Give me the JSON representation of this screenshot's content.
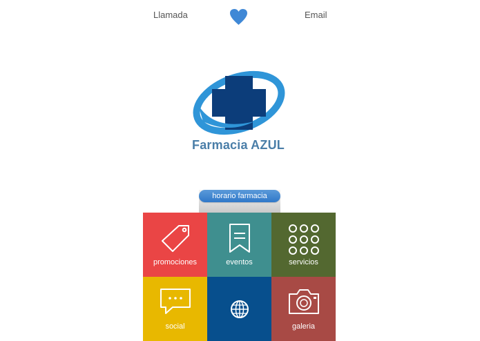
{
  "header": {
    "call_label": "Llamada",
    "email_label": "Email",
    "favorite_icon": "heart-icon"
  },
  "brand": {
    "name": "Farmacia AZUL",
    "logo_icon": "cross-logo-icon",
    "primary_color": "#0c3d7a",
    "accent_color": "#2f95d8"
  },
  "hours": {
    "label": "horario farmacia",
    "color": "#3a84d4"
  },
  "tiles": [
    {
      "label": "promociones",
      "icon": "tag-icon",
      "color": "#ea4545"
    },
    {
      "label": "eventos",
      "icon": "bookmark-icon",
      "color": "#3f8f8f"
    },
    {
      "label": "servicios",
      "icon": "dots-grid-icon",
      "color": "#536830"
    },
    {
      "label": "social",
      "icon": "chat-bubble-icon",
      "color": "#e8b800"
    },
    {
      "label": "",
      "icon": "globe-icon",
      "color": "#074f8d"
    },
    {
      "label": "galeria",
      "icon": "camera-icon",
      "color": "#a84a45"
    }
  ]
}
